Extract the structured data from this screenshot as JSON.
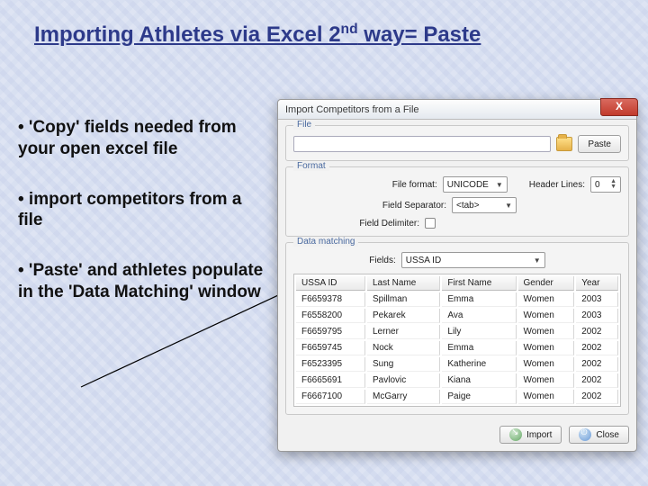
{
  "slide": {
    "title_prefix": "Importing Athletes via Excel 2",
    "title_sup": "nd",
    "title_suffix": " way= Paste",
    "bullet1": "• 'Copy' fields needed from  your open excel file",
    "bullet2": "• import competitors from a file",
    "bullet3": "• 'Paste' and athletes populate in the 'Data Matching' window"
  },
  "dialog": {
    "title": "Import Competitors from a File",
    "close_glyph": "X",
    "groups": {
      "file": {
        "legend": "File",
        "path_value": "",
        "paste_label": "Paste"
      },
      "format": {
        "legend": "Format",
        "file_format_label": "File format:",
        "file_format_value": "UNICODE",
        "header_lines_label": "Header Lines:",
        "header_lines_value": "0",
        "field_separator_label": "Field Separator:",
        "field_separator_value": "<tab>",
        "field_delimiter_label": "Field Delimiter:"
      },
      "matching": {
        "legend": "Data matching",
        "fields_label": "Fields:",
        "fields_value": "USSA ID"
      }
    },
    "table": {
      "headers": [
        "USSA ID",
        "Last Name",
        "First Name",
        "Gender",
        "Year"
      ],
      "rows": [
        [
          "F6659378",
          "Spillman",
          "Emma",
          "Women",
          "2003"
        ],
        [
          "F6558200",
          "Pekarek",
          "Ava",
          "Women",
          "2003"
        ],
        [
          "F6659795",
          "Lerner",
          "Lily",
          "Women",
          "2002"
        ],
        [
          "F6659745",
          "Nock",
          "Emma",
          "Women",
          "2002"
        ],
        [
          "F6523395",
          "Sung",
          "Katherine",
          "Women",
          "2002"
        ],
        [
          "F6665691",
          "Pavlovic",
          "Kiana",
          "Women",
          "2002"
        ],
        [
          "F6667100",
          "McGarry",
          "Paige",
          "Women",
          "2002"
        ]
      ]
    },
    "buttons": {
      "import": "Import",
      "close": "Close"
    }
  }
}
